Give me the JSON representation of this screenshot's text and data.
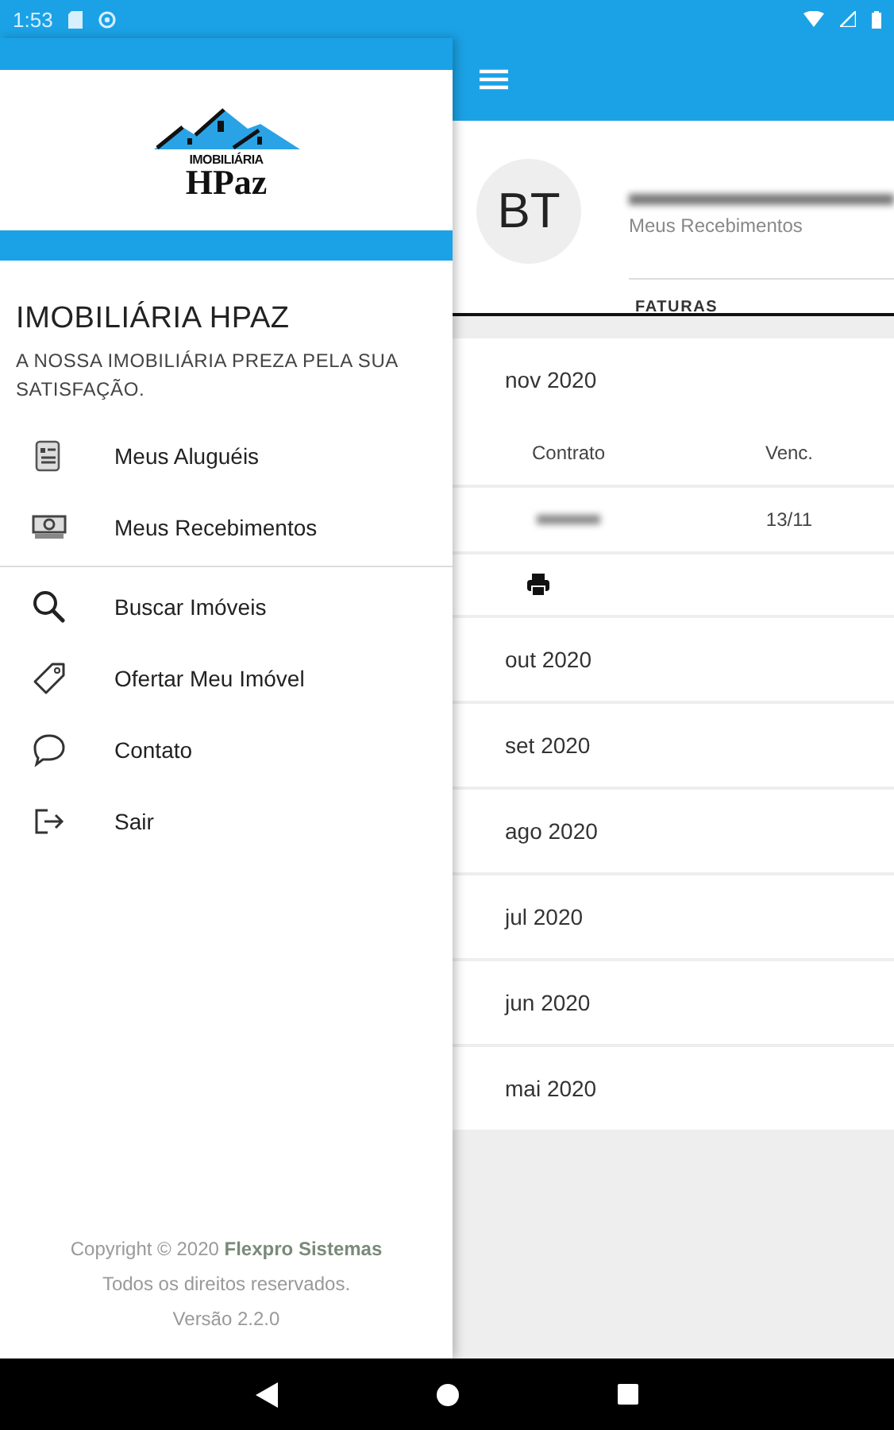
{
  "status_bar": {
    "time": "1:53"
  },
  "drawer": {
    "logo": {
      "line_1": "IMOBILIÁRIA",
      "line_2": "HPaz"
    },
    "title": "IMOBILIÁRIA HPAZ",
    "subtitle": "A NOSSA IMOBILIÁRIA PREZA PELA SUA SATISFAÇÃO.",
    "menu_groups": [
      {
        "items": [
          {
            "label": "Meus Aluguéis"
          },
          {
            "label": "Meus Recebimentos"
          }
        ]
      },
      {
        "items": [
          {
            "label": "Buscar Imóveis"
          },
          {
            "label": "Ofertar Meu Imóvel"
          },
          {
            "label": "Contato"
          },
          {
            "label": "Sair"
          }
        ]
      }
    ],
    "footer": [
      "Copyright © 2020 **Flexpro Sistemas**",
      "Todos os direitos reservados.",
      "Versão 2.2.0"
    ]
  },
  "profile": {
    "initials": "BT",
    "subtitle": "Meus Recebimentos"
  },
  "tabs": [
    {
      "label": "FATURAS",
      "selected": true
    }
  ],
  "months": [
    {
      "label": "nov 2020",
      "table": {
        "columns": [
          "Contrato",
          "Venc."
        ],
        "rows": [
          {
            "due": "13/11"
          }
        ]
      }
    },
    {
      "label": "out 2020"
    },
    {
      "label": "set 2020"
    },
    {
      "label": "ago 2020"
    },
    {
      "label": "jul 2020"
    },
    {
      "label": "jun 2020"
    },
    {
      "label": "mai 2020"
    }
  ]
}
